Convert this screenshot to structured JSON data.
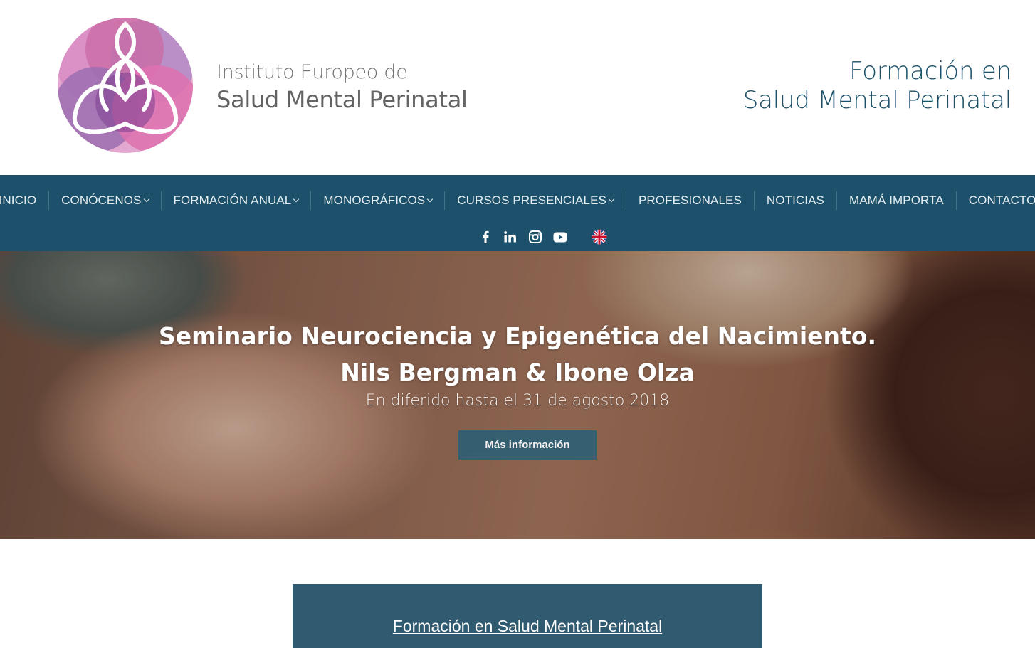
{
  "header": {
    "logo_line1": "Instituto Europeo de",
    "logo_line2": "Salud Mental Perinatal",
    "tagline_line1": "Formación en",
    "tagline_line2": "Salud Mental Perinatal"
  },
  "nav": {
    "items": [
      {
        "label": "INICIO"
      },
      {
        "label": "CONÓCENOS"
      },
      {
        "label": "FORMACIÓN ANUAL"
      },
      {
        "label": "MONOGRÁFICOS"
      },
      {
        "label": "CURSOS PRESENCIALES"
      },
      {
        "label": "PROFESIONALES"
      },
      {
        "label": "NOTICIAS"
      },
      {
        "label": "MAMÁ IMPORTA"
      },
      {
        "label": "CONTACTO"
      }
    ],
    "social": [
      "facebook-icon",
      "linkedin-icon",
      "instagram-icon",
      "youtube-icon",
      "uk-flag-icon"
    ]
  },
  "hero": {
    "title_line1": "Seminario Neurociencia y Epigenética del Nacimiento.",
    "title_line2": "Nils Bergman & Ibone Olza",
    "subtitle": "En diferido hasta el 31 de agosto 2018",
    "button_label": "Más información"
  },
  "info_box": {
    "link_label": "Formación en Salud Mental Perinatal"
  },
  "colors": {
    "nav_bg": "#1d516b",
    "tagline": "#1b5068",
    "button_bg": "#2f5f74",
    "box_bg": "#2f5a70"
  }
}
